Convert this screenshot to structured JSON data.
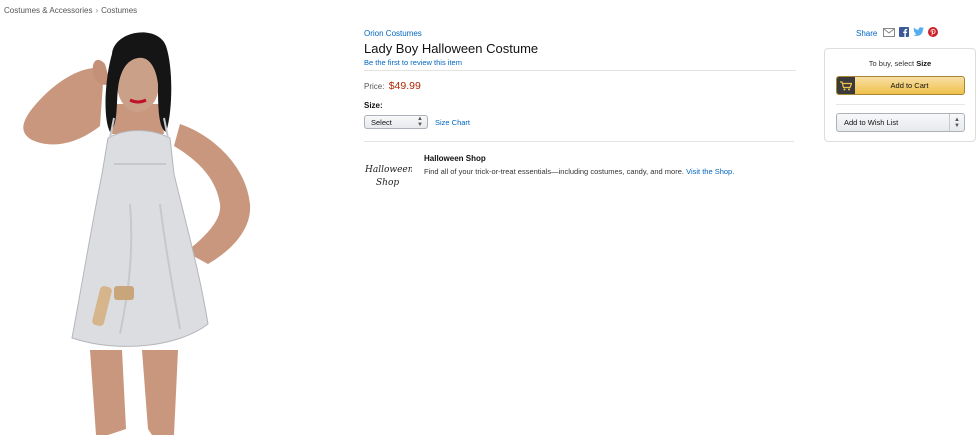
{
  "breadcrumb": {
    "items": [
      "Costumes & Accessories",
      "Costumes"
    ],
    "separator": "›"
  },
  "product": {
    "brand": "Orion Costumes",
    "title": "Lady Boy Halloween Costume",
    "review_link": "Be the first to review this item",
    "price_label": "Price:",
    "price": "$49.99",
    "size_label": "Size:",
    "size_select": "Select",
    "size_chart": "Size Chart"
  },
  "promo": {
    "logo_text": [
      "Halloween",
      "Shop"
    ],
    "title": "Halloween Shop",
    "description": "Find all of your trick-or-treat essentials—including costumes, candy, and more.",
    "link": "Visit the Shop."
  },
  "share": {
    "label": "Share",
    "icons": [
      "email-icon",
      "facebook-icon",
      "twitter-icon",
      "pinterest-icon"
    ]
  },
  "buybox": {
    "hint_prefix": "To buy, select ",
    "hint_bold": "Size",
    "add_to_cart": "Add to Cart",
    "add_to_wish_list": "Add to Wish List"
  },
  "colors": {
    "link": "#0066c0",
    "price": "#b12704",
    "cart_button": "#f0c14b"
  }
}
